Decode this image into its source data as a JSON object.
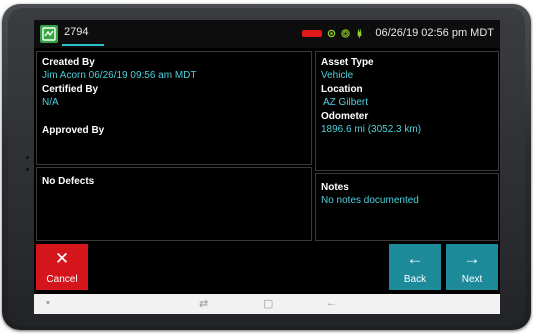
{
  "header": {
    "tab_label": "2794",
    "datetime": "06/26/19 02:56 pm MDT",
    "status_icons": [
      "battery-icon",
      "gps-icon",
      "connection-icon",
      "power-icon"
    ],
    "battery_color": "#e11818",
    "status_icon_color": "#8fd12d"
  },
  "left_panel": {
    "created_by_label": "Created By",
    "created_by_value": "Jim Acorn 06/26/19 09:56 am MDT",
    "certified_by_label": "Certified By",
    "certified_by_value": "N/A",
    "approved_by_label": "Approved By"
  },
  "right_panel": {
    "asset_type_label": "Asset Type",
    "asset_type_value": "Vehicle",
    "location_label": "Location",
    "location_value": "AZ Gilbert",
    "odometer_label": "Odometer",
    "odometer_value": "1896.6 mi (3052.3 km)"
  },
  "defects": {
    "label": "No Defects"
  },
  "notes": {
    "label": "Notes",
    "value": "No notes documented"
  },
  "buttons": {
    "cancel_icon": "✕",
    "cancel_label": "Cancel",
    "back_icon": "←",
    "back_label": "Back",
    "next_icon": "→",
    "next_label": "Next"
  },
  "navbar": {
    "dot": "•",
    "recent": "⇄",
    "home": "▢",
    "back": "←"
  },
  "colors": {
    "accent": "#27c3c9",
    "value_text": "#4fd0dc",
    "cancel": "#d4161c",
    "nav_buttons": "#1d8a9a"
  }
}
